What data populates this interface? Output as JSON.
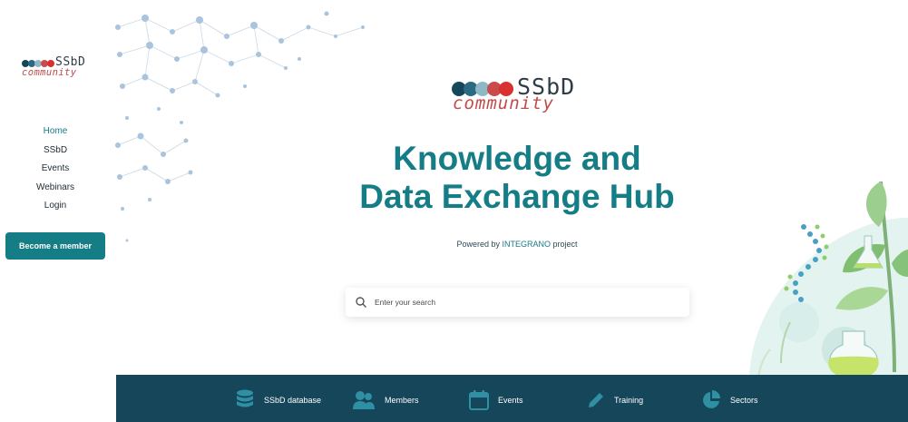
{
  "brand": {
    "name": "SSbD",
    "tagline": "community"
  },
  "sidebar": {
    "nav": [
      {
        "label": "Home",
        "active": true
      },
      {
        "label": "SSbD",
        "active": false
      },
      {
        "label": "Events",
        "active": false
      },
      {
        "label": "Webinars",
        "active": false
      },
      {
        "label": "Login",
        "active": false
      }
    ],
    "cta_label": "Become a member"
  },
  "hero": {
    "title_line1": "Knowledge and",
    "title_line2": "Data Exchange Hub",
    "powered_prefix": "Powered by ",
    "powered_link": "INTEGRANO",
    "powered_suffix": " project"
  },
  "search": {
    "placeholder": "Enter your search",
    "icon": "search-icon"
  },
  "bottom_nav": [
    {
      "label": "SSbD database",
      "icon": "database-icon"
    },
    {
      "label": "Members",
      "icon": "members-icon"
    },
    {
      "label": "Events",
      "icon": "calendar-icon"
    },
    {
      "label": "Training",
      "icon": "pencil-icon"
    },
    {
      "label": "Sectors",
      "icon": "pie-chart-icon"
    }
  ],
  "colors": {
    "accent": "#147d86",
    "bottom_bar": "#16465a",
    "brand_red": "#c24a4a",
    "brand_dark": "#2d3c46"
  }
}
